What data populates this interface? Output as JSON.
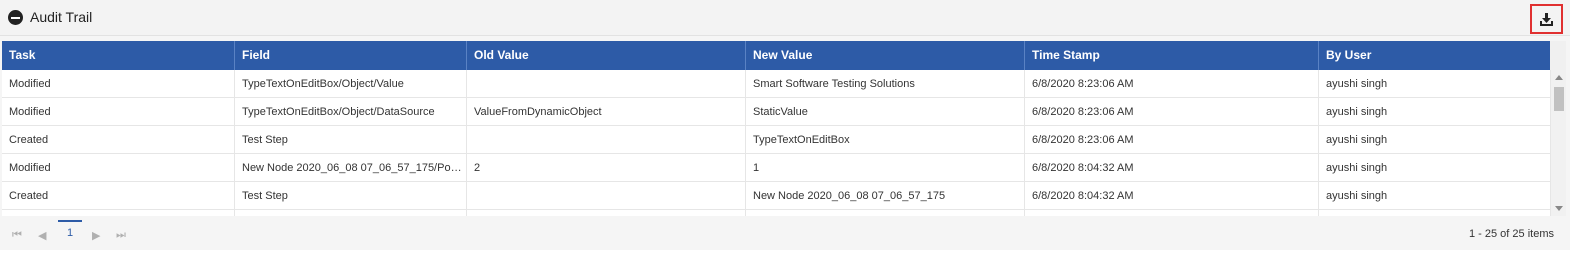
{
  "header": {
    "title": "Audit Trail",
    "collapse_icon": "minus-circle-icon",
    "export_icon": "download-icon"
  },
  "table": {
    "columns": [
      "Task",
      "Field",
      "Old Value",
      "New Value",
      "Time Stamp",
      "By User"
    ],
    "rows": [
      [
        "Modified",
        "TypeTextOnEditBox/Object/Value",
        "",
        "Smart Software Testing Solutions",
        "6/8/2020 8:23:06 AM",
        "ayushi singh"
      ],
      [
        "Modified",
        "TypeTextOnEditBox/Object/DataSource",
        "ValueFromDynamicObject",
        "StaticValue",
        "6/8/2020 8:23:06 AM",
        "ayushi singh"
      ],
      [
        "Created",
        "Test Step",
        "",
        "TypeTextOnEditBox",
        "6/8/2020 8:23:06 AM",
        "ayushi singh"
      ],
      [
        "Modified",
        "New Node 2020_06_08 07_06_57_175/Positi...",
        "2",
        "1",
        "6/8/2020 8:04:32 AM",
        "ayushi singh"
      ],
      [
        "Created",
        "Test Step",
        "",
        "New Node 2020_06_08 07_06_57_175",
        "6/8/2020 8:04:32 AM",
        "ayushi singh"
      ],
      [
        "",
        "",
        "",
        "",
        "",
        ""
      ]
    ]
  },
  "pager": {
    "first": "⏮",
    "prev": "◀",
    "page": "1",
    "next": "▶",
    "last": "⏭",
    "info": "1 - 25 of 25 items"
  }
}
